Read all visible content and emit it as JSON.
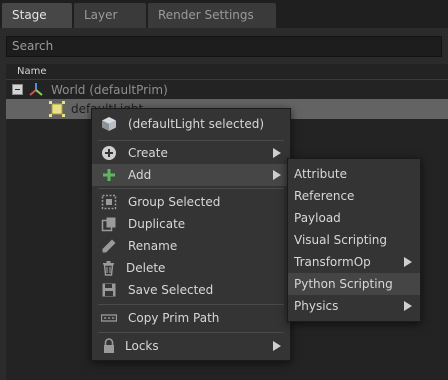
{
  "tabs": [
    {
      "label": "Stage",
      "active": true
    },
    {
      "label": "Layer",
      "active": false
    },
    {
      "label": "Render Settings",
      "active": false
    }
  ],
  "search": {
    "placeholder": "Search"
  },
  "tree": {
    "column_header": "Name",
    "rows": [
      {
        "label": "World (defaultPrim)",
        "icon": "world-axis-icon"
      },
      {
        "label": "defaultLight",
        "icon": "light-icon",
        "selected": true
      }
    ]
  },
  "context_menu": {
    "header": "(defaultLight selected)",
    "items": [
      {
        "label": "Create",
        "icon": "plus-circle-icon",
        "submenu": true
      },
      {
        "label": "Add",
        "icon": "plus-icon",
        "submenu": true
      },
      {
        "label": "Group Selected",
        "icon": "group-icon"
      },
      {
        "label": "Duplicate",
        "icon": "duplicate-icon"
      },
      {
        "label": "Rename",
        "icon": "pencil-icon"
      },
      {
        "label": "Delete",
        "icon": "trash-icon"
      },
      {
        "label": "Save Selected",
        "icon": "save-icon"
      },
      {
        "label": "Copy Prim Path",
        "icon": "path-icon"
      },
      {
        "label": "Locks",
        "icon": "lock-icon",
        "submenu": true
      }
    ]
  },
  "add_submenu": {
    "items": [
      {
        "label": "Attribute"
      },
      {
        "label": "Reference"
      },
      {
        "label": "Payload"
      },
      {
        "label": "Visual Scripting"
      },
      {
        "label": "TransformOp",
        "submenu": true
      },
      {
        "label": "Python Scripting"
      },
      {
        "label": "Physics",
        "submenu": true
      }
    ]
  },
  "colors": {
    "background": "#262627",
    "menu_bg": "#343434",
    "selected_row": "#636363",
    "light_icon": "#e8e08a",
    "add_icon": "#5fb55f"
  }
}
